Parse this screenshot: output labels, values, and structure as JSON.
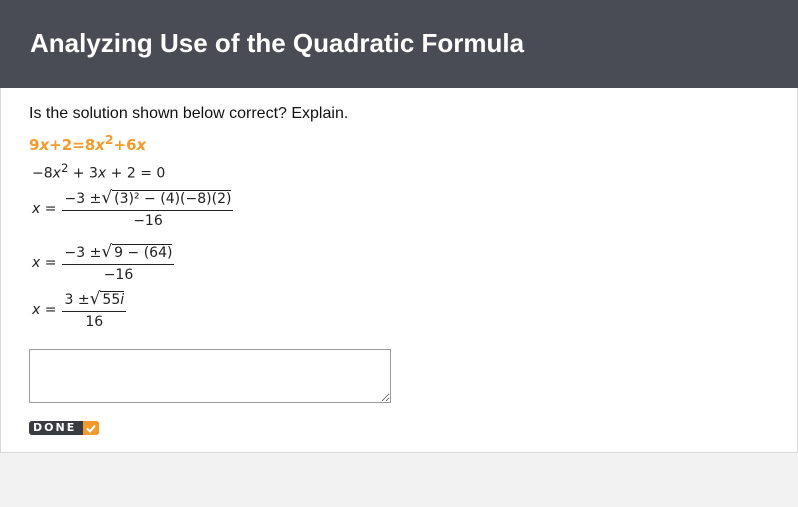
{
  "header": {
    "title": "Analyzing Use of the Quadratic Formula"
  },
  "question": {
    "prompt": "Is the solution shown below correct? Explain.",
    "given_equation": {
      "a": "9",
      "b": "x",
      "c": "+2=8",
      "d": "x",
      "e": "2",
      "f": "+6",
      "g": "x"
    },
    "steps": {
      "line1": {
        "lhs": "−8",
        "x": "x",
        "exp": "2",
        "rest": " + 3",
        "x2": "x",
        "tail": " + 2 = 0"
      },
      "line2": {
        "xvar": "x",
        "eq": "=",
        "num_pre": "−3 ±",
        "radicand": "(3)² − (4)(−8)(2)",
        "den": "−16"
      },
      "line3": {
        "xvar": "x",
        "eq": "=",
        "num_pre": "−3 ±",
        "radicand": "9 − (64)",
        "den": "−16"
      },
      "line4": {
        "xvar": "x",
        "eq": "=",
        "num_pre": "3 ±",
        "radicand": "55",
        "imag": "i",
        "den": "16"
      }
    }
  },
  "response": {
    "value": "",
    "placeholder": ""
  },
  "done_button": {
    "label": "DONE",
    "icon": "check-icon",
    "accent": "#f39a2c"
  }
}
